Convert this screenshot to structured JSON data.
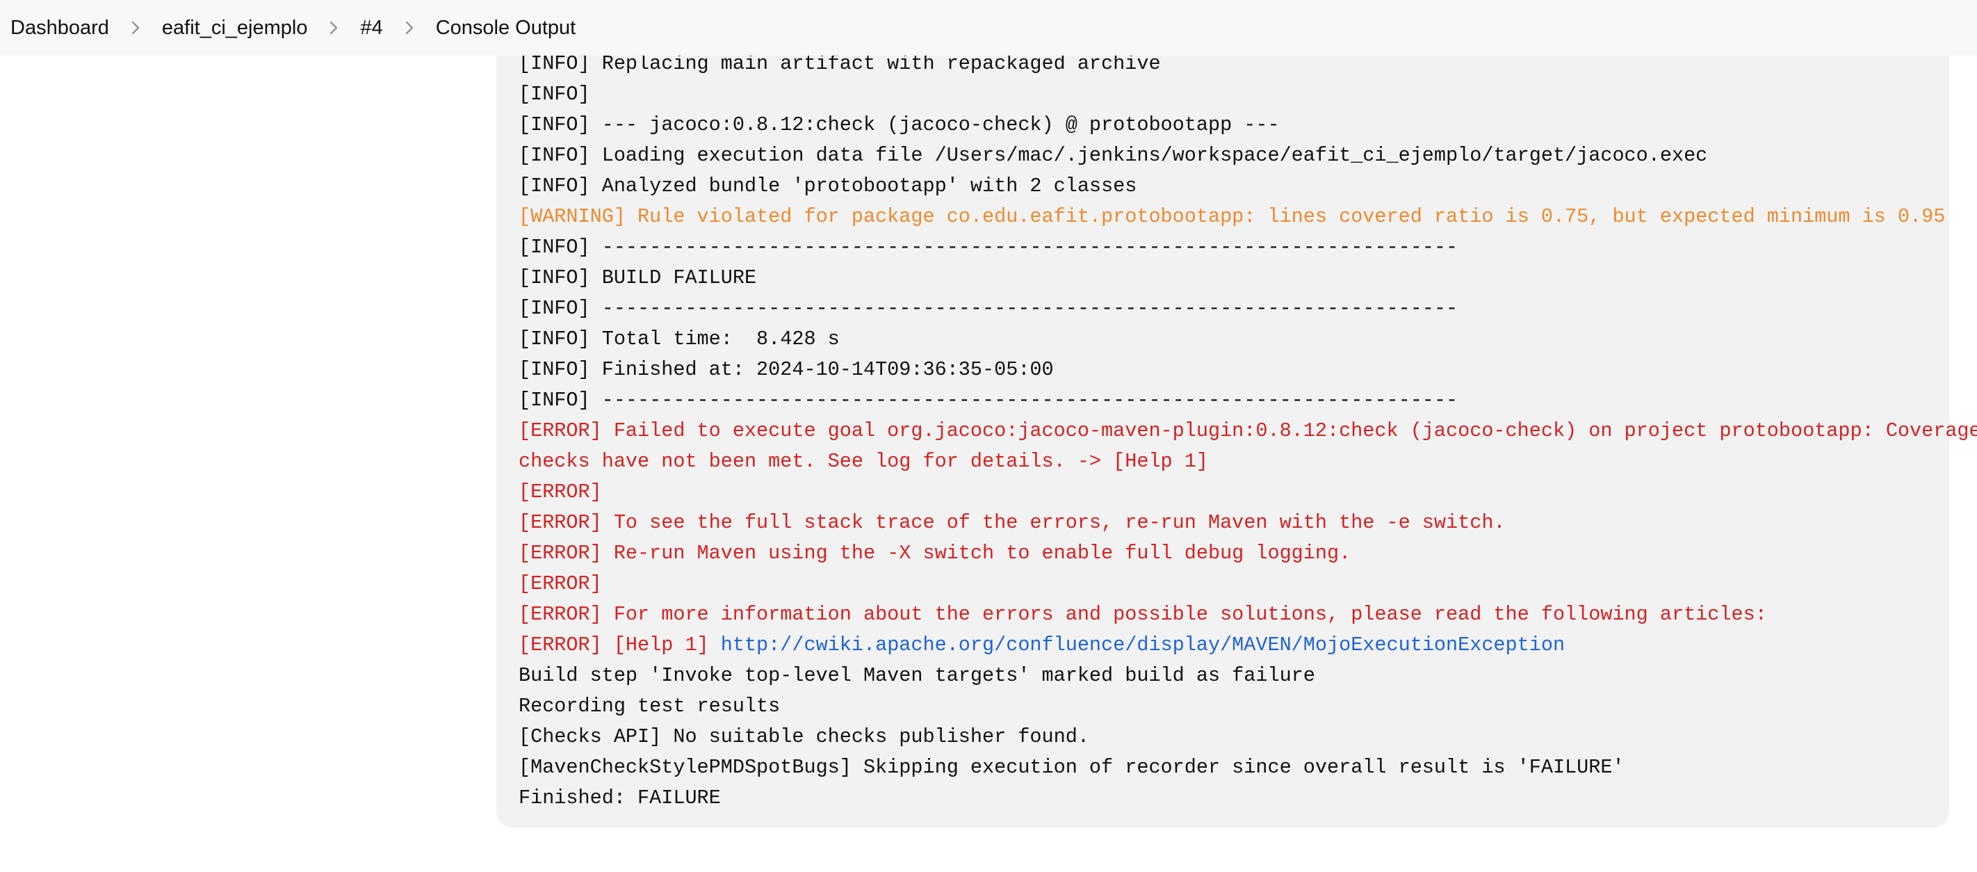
{
  "breadcrumb": [
    {
      "label": "Dashboard"
    },
    {
      "label": "eafit_ci_ejemplo"
    },
    {
      "label": "#4"
    },
    {
      "label": "Console Output"
    }
  ],
  "colors": {
    "warning": "#ee8a2e",
    "error": "#d62222",
    "link": "#1f63d6",
    "panel": "#f2f2f2"
  },
  "console": {
    "lines": [
      {
        "level": "info",
        "text": "[INFO] Replacing main artifact with repackaged archive"
      },
      {
        "level": "info",
        "text": "[INFO]"
      },
      {
        "level": "info",
        "text": "[INFO] --- jacoco:0.8.12:check (jacoco-check) @ protobootapp ---"
      },
      {
        "level": "info",
        "text": "[INFO] Loading execution data file /Users/mac/.jenkins/workspace/eafit_ci_ejemplo/target/jacoco.exec"
      },
      {
        "level": "info",
        "text": "[INFO] Analyzed bundle 'protobootapp' with 2 classes"
      },
      {
        "level": "warning",
        "text": "[WARNING] Rule violated for package co.edu.eafit.protobootapp: lines covered ratio is 0.75, but expected minimum is 0.95"
      },
      {
        "level": "info",
        "text": "[INFO] ------------------------------------------------------------------------"
      },
      {
        "level": "info",
        "text": "[INFO] BUILD FAILURE"
      },
      {
        "level": "info",
        "text": "[INFO] ------------------------------------------------------------------------"
      },
      {
        "level": "info",
        "text": "[INFO] Total time:  8.428 s"
      },
      {
        "level": "info",
        "text": "[INFO] Finished at: 2024-10-14T09:36:35-05:00"
      },
      {
        "level": "info",
        "text": "[INFO] ------------------------------------------------------------------------"
      },
      {
        "level": "error",
        "text": "[ERROR] Failed to execute goal org.jacoco:jacoco-maven-plugin:0.8.12:check (jacoco-check) on project protobootapp: Coverage"
      },
      {
        "level": "error",
        "text": "checks have not been met. See log for details. -> [Help 1]"
      },
      {
        "level": "error",
        "text": "[ERROR]"
      },
      {
        "level": "error",
        "text": "[ERROR] To see the full stack trace of the errors, re-run Maven with the -e switch."
      },
      {
        "level": "error",
        "text": "[ERROR] Re-run Maven using the -X switch to enable full debug logging."
      },
      {
        "level": "error",
        "text": "[ERROR]"
      },
      {
        "level": "error",
        "text": "[ERROR] For more information about the errors and possible solutions, please read the following articles:"
      },
      {
        "level": "error",
        "text": "[ERROR] [Help 1] ",
        "link": "http://cwiki.apache.org/confluence/display/MAVEN/MojoExecutionException"
      },
      {
        "level": "plain",
        "text": "Build step 'Invoke top-level Maven targets' marked build as failure"
      },
      {
        "level": "plain",
        "text": "Recording test results"
      },
      {
        "level": "plain",
        "text": "[Checks API] No suitable checks publisher found."
      },
      {
        "level": "plain",
        "text": "[MavenCheckStylePMDSpotBugs] Skipping execution of recorder since overall result is 'FAILURE'"
      },
      {
        "level": "plain",
        "text": "Finished: FAILURE"
      }
    ]
  }
}
